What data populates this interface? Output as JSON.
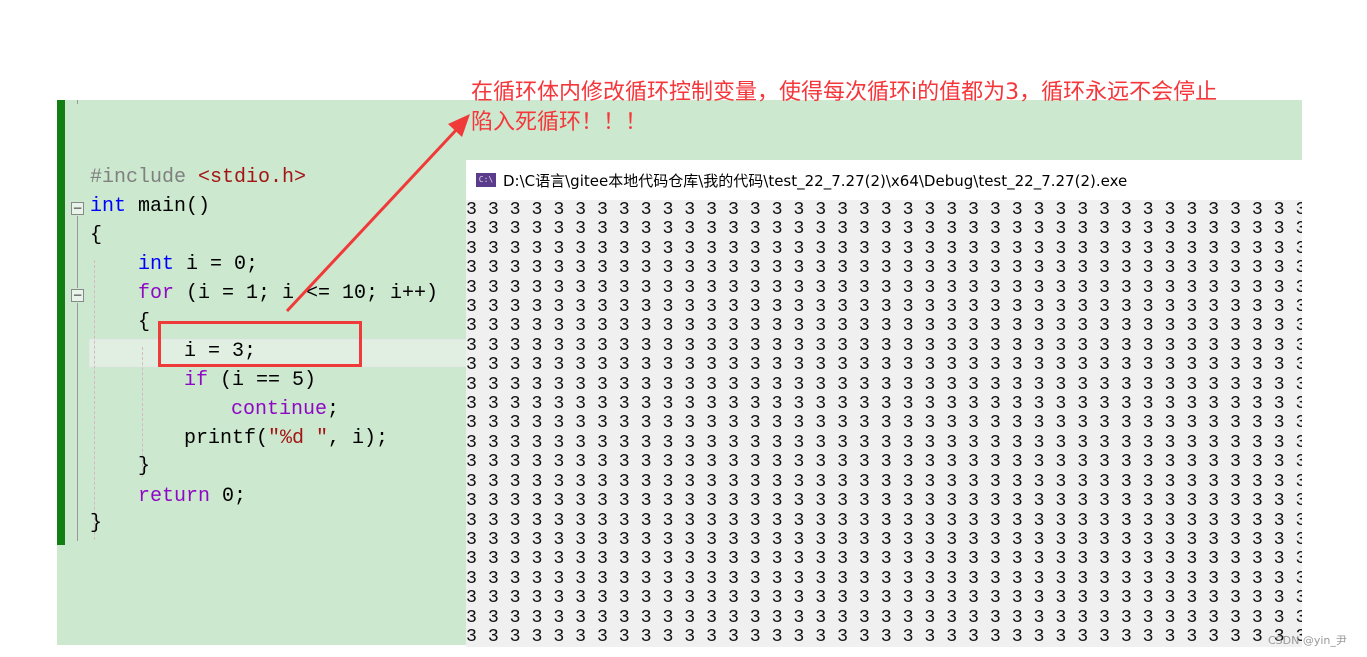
{
  "annotation": {
    "line1": "在循环体内修改循环控制变量，使得每次循环i的值都为3，循环永远不会停止",
    "line2": "陷入死循环！！！",
    "color": "#f5363a"
  },
  "editor": {
    "code": {
      "include_kw": "#include",
      "include_file": "<stdio.h>",
      "main_kw": "int",
      "main_rest": " main()",
      "open1": "{",
      "decl_kw": "int",
      "decl_rest": " i = 0;",
      "for_kw": "for",
      "for_rest": " (i = 1; i <= 10; i++)",
      "open2": "{",
      "assign": "i = 3;",
      "if_kw": "if",
      "if_rest": " (i == 5)",
      "continue_kw": "continue",
      "continue_rest": ";",
      "printf_a": "printf(",
      "printf_str": "\"%d \"",
      "printf_b": ", i);",
      "close2": "}",
      "return_kw": "return",
      "return_rest": " 0;",
      "close1": "}"
    }
  },
  "console": {
    "icon": "console-app-icon",
    "title": "D:\\C语言\\gitee本地代码仓库\\我的代码\\test_22_7.27(2)\\x64\\Debug\\test_22_7.27(2).exe",
    "output": "3 3 3 3 3 3 3 3 3 3 3 3 3 3 3 3 3 3 3 3 3 3 3 3 3 3 3 3 3 3 3 3 3 3 3 3 3 3 3\n3 3 3 3 3 3 3 3 3 3 3 3 3 3 3 3 3 3 3 3 3 3 3 3 3 3 3 3 3 3 3 3 3 3 3 3 3 3 3\n3 3 3 3 3 3 3 3 3 3 3 3 3 3 3 3 3 3 3 3 3 3 3 3 3 3 3 3 3 3 3 3 3 3 3 3 3 3 3\n3 3 3 3 3 3 3 3 3 3 3 3 3 3 3 3 3 3 3 3 3 3 3 3 3 3 3 3 3 3 3 3 3 3 3 3 3 3 3\n3 3 3 3 3 3 3 3 3 3 3 3 3 3 3 3 3 3 3 3 3 3 3 3 3 3 3 3 3 3 3 3 3 3 3 3 3 3 3\n3 3 3 3 3 3 3 3 3 3 3 3 3 3 3 3 3 3 3 3 3 3 3 3 3 3 3 3 3 3 3 3 3 3 3 3 3 3 3\n3 3 3 3 3 3 3 3 3 3 3 3 3 3 3 3 3 3 3 3 3 3 3 3 3 3 3 3 3 3 3 3 3 3 3 3 3 3 3\n3 3 3 3 3 3 3 3 3 3 3 3 3 3 3 3 3 3 3 3 3 3 3 3 3 3 3 3 3 3 3 3 3 3 3 3 3 3 3\n3 3 3 3 3 3 3 3 3 3 3 3 3 3 3 3 3 3 3 3 3 3 3 3 3 3 3 3 3 3 3 3 3 3 3 3 3 3 3\n3 3 3 3 3 3 3 3 3 3 3 3 3 3 3 3 3 3 3 3 3 3 3 3 3 3 3 3 3 3 3 3 3 3 3 3 3 3 3\n3 3 3 3 3 3 3 3 3 3 3 3 3 3 3 3 3 3 3 3 3 3 3 3 3 3 3 3 3 3 3 3 3 3 3 3 3 3 3\n3 3 3 3 3 3 3 3 3 3 3 3 3 3 3 3 3 3 3 3 3 3 3 3 3 3 3 3 3 3 3 3 3 3 3 3 3 3 3\n3 3 3 3 3 3 3 3 3 3 3 3 3 3 3 3 3 3 3 3 3 3 3 3 3 3 3 3 3 3 3 3 3 3 3 3 3 3 3\n3 3 3 3 3 3 3 3 3 3 3 3 3 3 3 3 3 3 3 3 3 3 3 3 3 3 3 3 3 3 3 3 3 3 3 3 3 3 3\n3 3 3 3 3 3 3 3 3 3 3 3 3 3 3 3 3 3 3 3 3 3 3 3 3 3 3 3 3 3 3 3 3 3 3 3 3 3 3\n3 3 3 3 3 3 3 3 3 3 3 3 3 3 3 3 3 3 3 3 3 3 3 3 3 3 3 3 3 3 3 3 3 3 3 3 3 3 3\n3 3 3 3 3 3 3 3 3 3 3 3 3 3 3 3 3 3 3 3 3 3 3 3 3 3 3 3 3 3 3 3 3 3 3 3 3 3 3\n3 3 3 3 3 3 3 3 3 3 3 3 3 3 3 3 3 3 3 3 3 3 3 3 3 3 3 3 3 3 3 3 3 3 3 3 3 3 3\n3 3 3 3 3 3 3 3 3 3 3 3 3 3 3 3 3 3 3 3 3 3 3 3 3 3 3 3 3 3 3 3 3 3 3 3 3 3 3\n3 3 3 3 3 3 3 3 3 3 3 3 3 3 3 3 3 3 3 3 3 3 3 3 3 3 3 3 3 3 3 3 3 3 3 3 3 3 3\n3 3 3 3 3 3 3 3 3 3 3 3 3 3 3 3 3 3 3 3 3 3 3 3 3 3 3 3 3 3 3 3 3 3 3 3 3 3 3\n3 3 3 3 3 3 3 3 3 3 3 3 3 3 3 3 3 3 3 3 3 3 3 3 3 3 3 3 3 3 3 3 3 3 3 3 3 3 3\n3 3 3 3 3 3 3 3 3 3 3 3 3 3 3 3 3 3 3 3 3 3 3 3 3 3 3 3 3 3 3 3 3 3 3 3 3 3 3"
  },
  "watermark": "CSDN @yin_尹"
}
